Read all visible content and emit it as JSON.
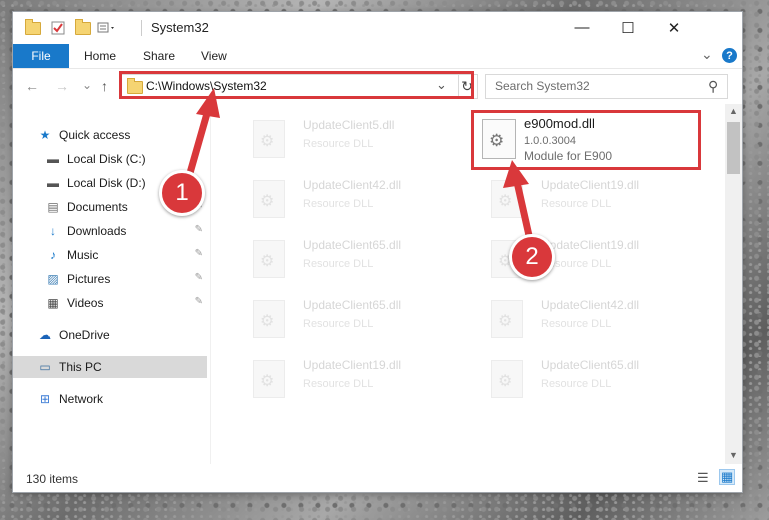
{
  "window": {
    "title": "System32",
    "minimize_icon": "—",
    "maximize_icon": "☐",
    "close_icon": "✕"
  },
  "ribbon": {
    "tabs": [
      "File",
      "Home",
      "Share",
      "View"
    ],
    "expand_icon": "⌄",
    "help_icon": "?"
  },
  "nav": {
    "back_icon": "←",
    "forward_icon": "→",
    "history_icon": "⌄",
    "up_icon": "↑",
    "address_value": "C:\\Windows\\System32",
    "dropdown_icon": "⌄",
    "refresh_icon": "↻",
    "search_placeholder": "Search System32",
    "search_icon": "⚲"
  },
  "sidebar": {
    "items": [
      {
        "label": "Quick access",
        "icon": "star-icon",
        "glyph": "★",
        "pinned": false
      },
      {
        "label": "Local Disk (C:)",
        "icon": "drive-icon",
        "glyph": "▬",
        "pinned": false
      },
      {
        "label": "Local Disk (D:)",
        "icon": "drive-icon",
        "glyph": "▬",
        "pinned": true
      },
      {
        "label": "Documents",
        "icon": "documents-icon",
        "glyph": "▤",
        "pinned": true
      },
      {
        "label": "Downloads",
        "icon": "download-icon",
        "glyph": "↓",
        "pinned": true
      },
      {
        "label": "Music",
        "icon": "music-icon",
        "glyph": "♪",
        "pinned": true
      },
      {
        "label": "Pictures",
        "icon": "pictures-icon",
        "glyph": "▨",
        "pinned": true
      },
      {
        "label": "Videos",
        "icon": "videos-icon",
        "glyph": "▦",
        "pinned": true
      },
      {
        "label": "OneDrive",
        "icon": "cloud-icon",
        "glyph": "☁",
        "pinned": false
      },
      {
        "label": "This PC",
        "icon": "computer-icon",
        "glyph": "▭",
        "pinned": false,
        "selected": true
      },
      {
        "label": "Network",
        "icon": "network-icon",
        "glyph": "⊞",
        "pinned": false
      }
    ],
    "pin_glyph": "✎"
  },
  "files": {
    "left_column": [
      {
        "name": "UpdateClient5.dll",
        "type": "Resource DLL"
      },
      {
        "name": "UpdateClient42.dll",
        "type": "Resource DLL"
      },
      {
        "name": "UpdateClient65.dll",
        "type": "Resource DLL"
      },
      {
        "name": "UpdateClient65.dll",
        "type": "Resource DLL"
      },
      {
        "name": "UpdateClient19.dll",
        "type": "Resource DLL"
      }
    ],
    "right_column": [
      {
        "name": "UpdateClient19.dll",
        "type": "Resource DLL"
      },
      {
        "name": "UpdateClient19.dll",
        "type": "Resource DLL"
      },
      {
        "name": "UpdateClient42.dll",
        "type": "Resource DLL"
      },
      {
        "name": "UpdateClient65.dll",
        "type": "Resource DLL"
      }
    ],
    "highlighted": {
      "name": "e900mod.dll",
      "version": "1.0.0.3004",
      "description": "Module for E900"
    }
  },
  "status": {
    "item_count": "130 items",
    "details_view_icon": "☰",
    "tiles_view_icon": "▦"
  },
  "callouts": [
    "1",
    "2"
  ],
  "colors": {
    "accent": "#1979ca",
    "highlight": "#d9383b"
  }
}
